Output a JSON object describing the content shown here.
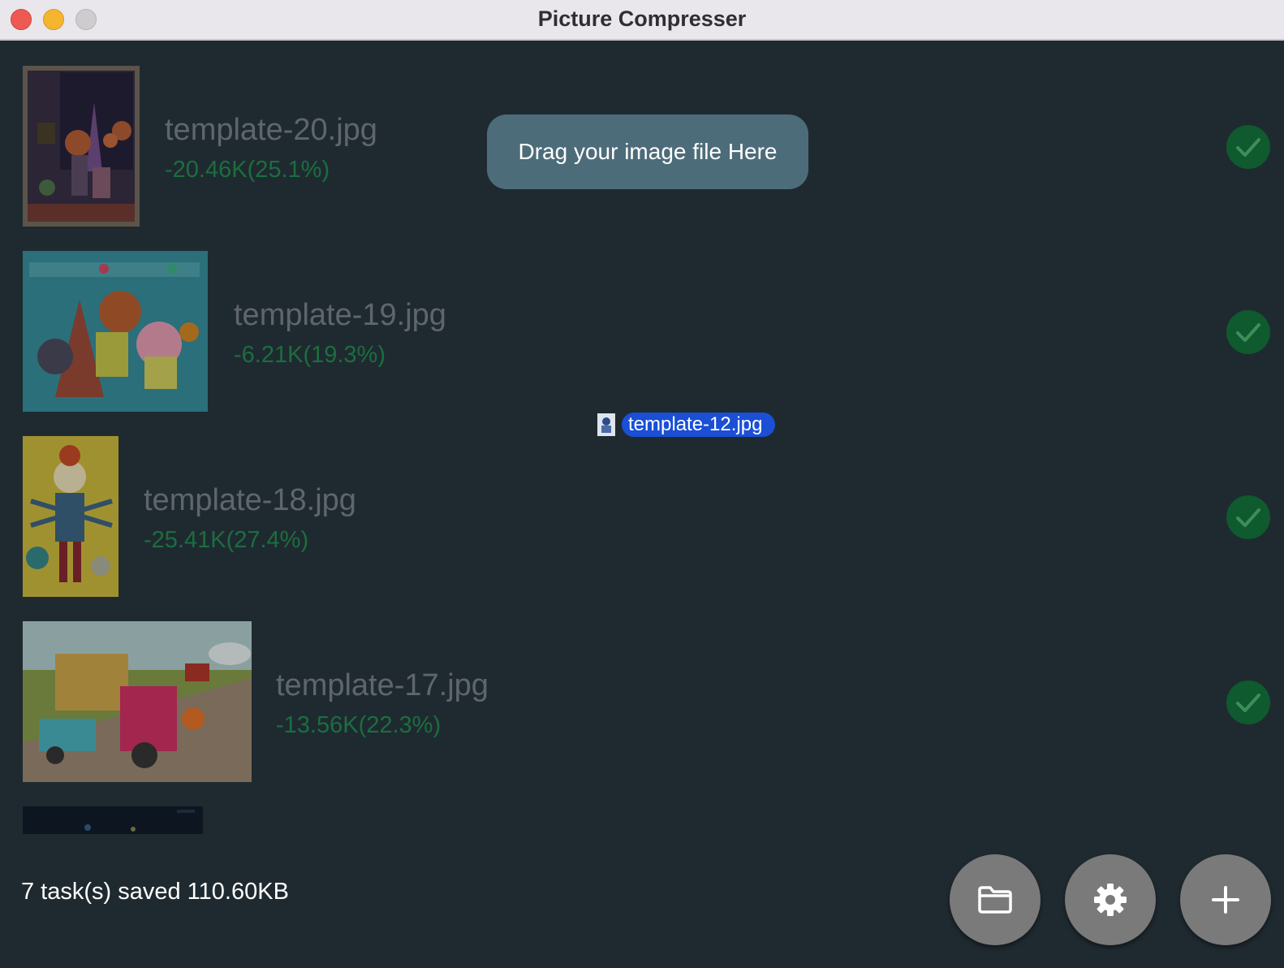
{
  "window": {
    "title": "Picture Compresser"
  },
  "drop_zone": {
    "label": "Drag your image file Here"
  },
  "drag_ghost": {
    "label": "template-12.jpg"
  },
  "files": [
    {
      "name": "template-20.jpg",
      "saved": "-20.46K(25.1%)",
      "status": "done"
    },
    {
      "name": "template-19.jpg",
      "saved": "-6.21K(19.3%)",
      "status": "done"
    },
    {
      "name": "template-18.jpg",
      "saved": "-25.41K(27.4%)",
      "status": "done"
    },
    {
      "name": "template-17.jpg",
      "saved": "-13.56K(22.3%)",
      "status": "done"
    }
  ],
  "status": {
    "summary": "7 task(s) saved 110.60KB"
  },
  "actions": [
    {
      "name": "open-folder",
      "icon": "folder-icon"
    },
    {
      "name": "settings",
      "icon": "gear-icon"
    },
    {
      "name": "add",
      "icon": "plus-icon"
    }
  ],
  "colors": {
    "background": "#1f2a30",
    "drop_zone": "#4d6c7a",
    "saved_text": "#1b6e3f",
    "check_badge": "#0f5a2e",
    "fab": "#7a7a7a",
    "selection": "#1a4fd6"
  }
}
